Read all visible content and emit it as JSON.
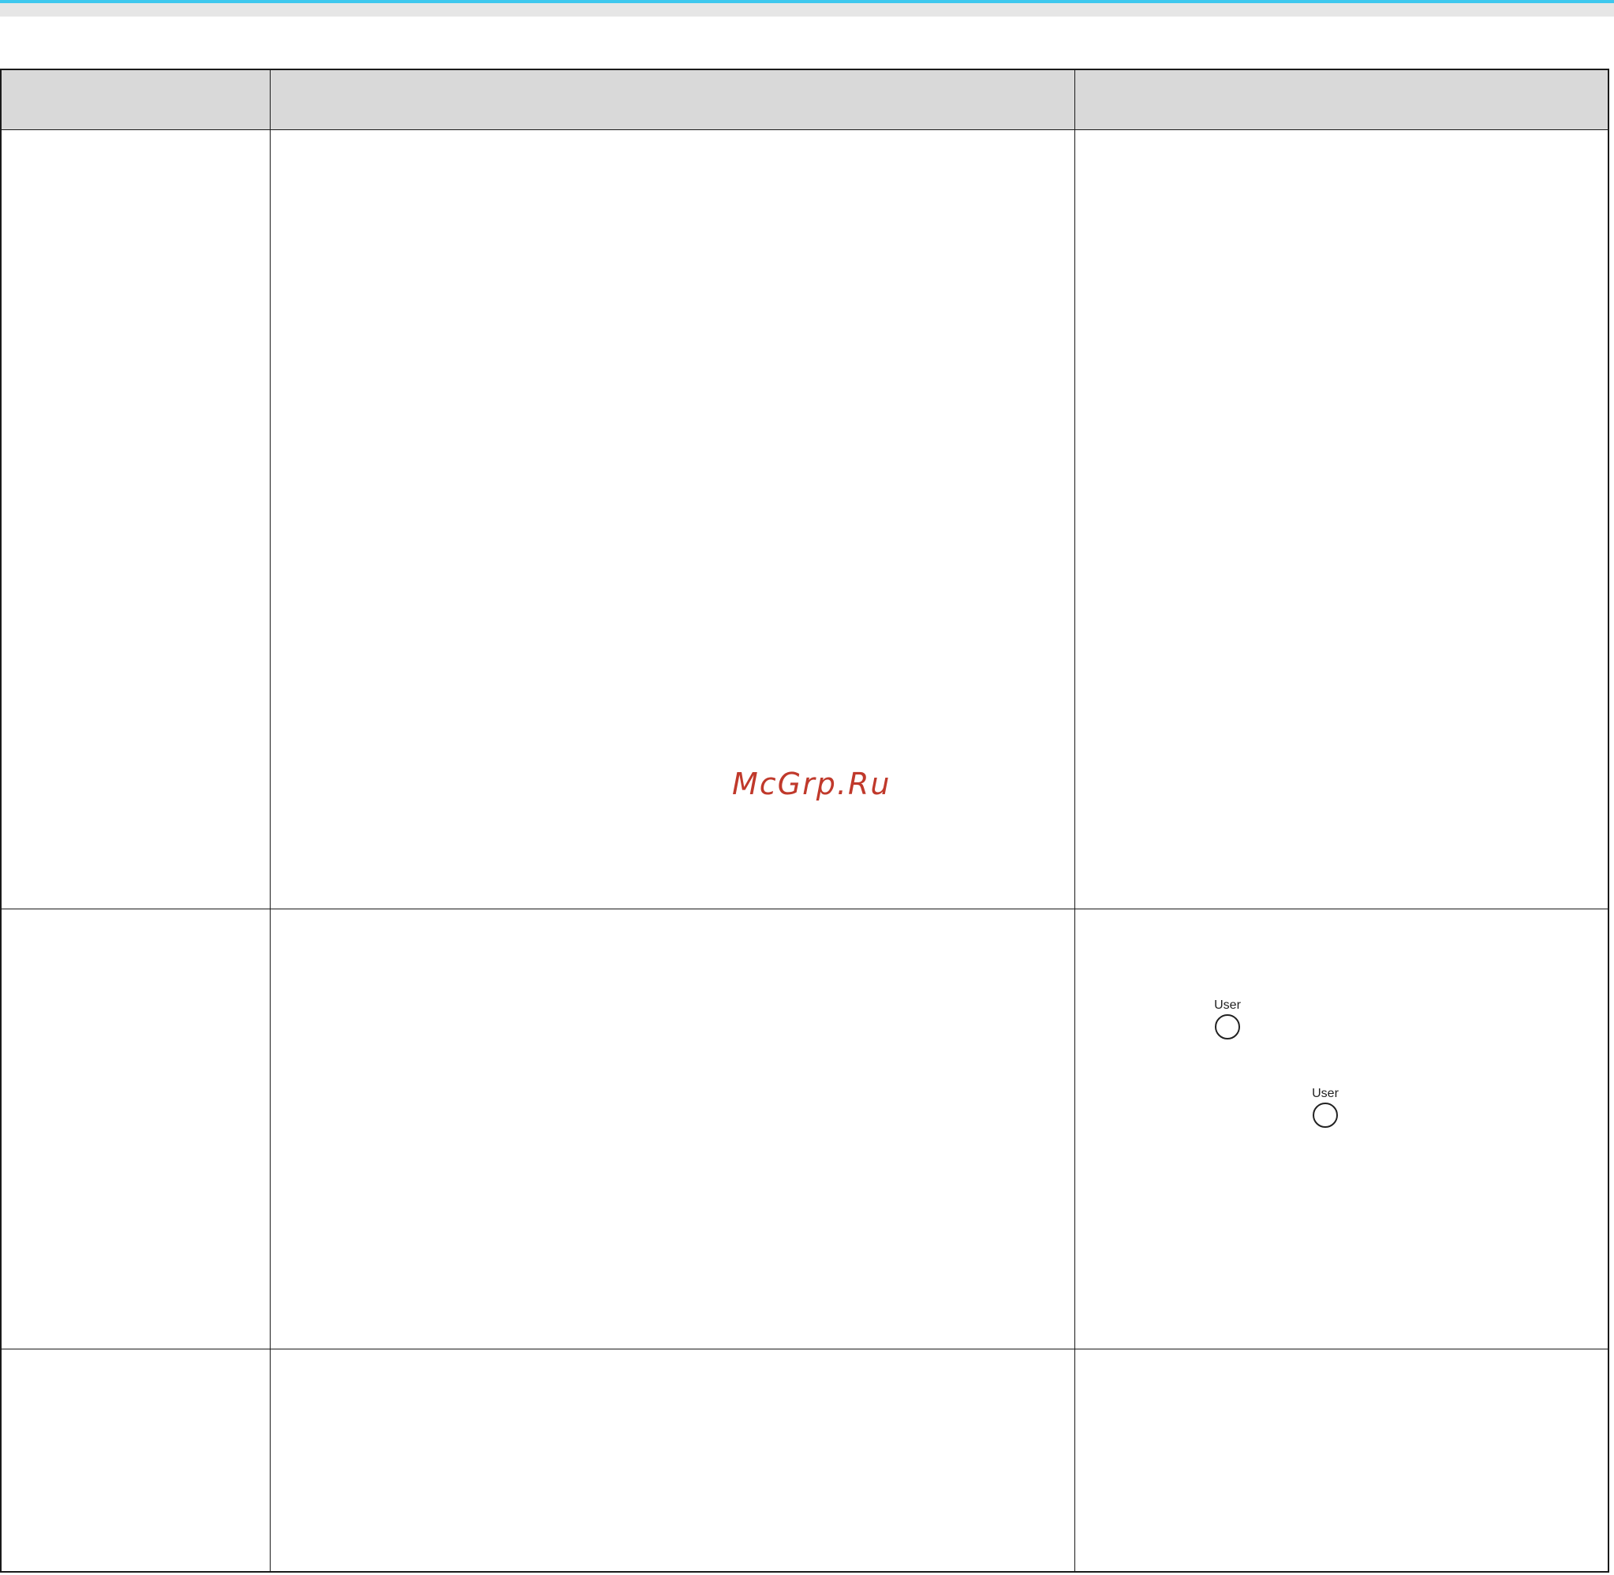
{
  "page": {
    "accent_color": "#3ec8ee",
    "band_color": "#e6e6e6",
    "header_fill": "#d9d9d9",
    "border_color": "#1a1a1a"
  },
  "table": {
    "headers": [
      "",
      "",
      ""
    ],
    "rows": [
      {
        "cells": [
          "",
          "",
          ""
        ]
      },
      {
        "cells": [
          "",
          "",
          ""
        ]
      },
      {
        "cells": [
          "",
          "",
          ""
        ]
      }
    ]
  },
  "buttons": {
    "user_1": {
      "label": "User",
      "icon": "user-button-icon"
    },
    "user_2": {
      "label": "User",
      "icon": "user-button-icon"
    }
  },
  "watermark": {
    "text": "McGrp.Ru",
    "color": "#c0392b"
  }
}
